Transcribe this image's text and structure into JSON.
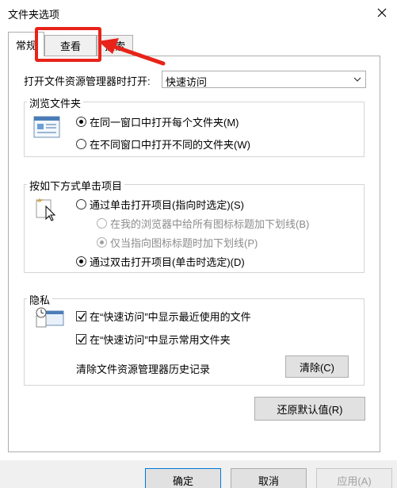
{
  "window": {
    "title": "文件夹选项",
    "close_icon": "close-icon"
  },
  "tabs": [
    {
      "label": "常规",
      "active": true
    },
    {
      "label": "查看",
      "active": false
    },
    {
      "label": "搜索",
      "active": false
    }
  ],
  "general": {
    "open_label": "打开文件资源管理器时打开:",
    "open_value": "快速访问",
    "browse": {
      "title": "浏览文件夹",
      "option_same": "在同一窗口中打开每个文件夹(M)",
      "option_new": "在不同窗口中打开不同的文件夹(W)",
      "selected": "same"
    },
    "click": {
      "title": "按如下方式单击项目",
      "single": "通过单击打开项目(指向时选定)(S)",
      "underline_all": "在我的浏览器中给所有图标标题加下划线(B)",
      "underline_point": "仅当指向图标标题时加下划线(P)",
      "double": "通过双击打开项目(单击时选定)(D)",
      "selected": "double"
    },
    "privacy": {
      "title": "隐私",
      "recent_files": "在“快速访问”中显示最近使用的文件",
      "frequent_folders": "在“快速访问”中显示常用文件夹",
      "recent_checked": true,
      "frequent_checked": true,
      "clear_label": "清除文件资源管理器历史记录",
      "clear_button": "清除(C)"
    },
    "restore_button": "还原默认值(R)"
  },
  "footer": {
    "ok": "确定",
    "cancel": "取消",
    "apply": "应用(A)"
  },
  "annotation": {
    "color": "#e8231a"
  }
}
